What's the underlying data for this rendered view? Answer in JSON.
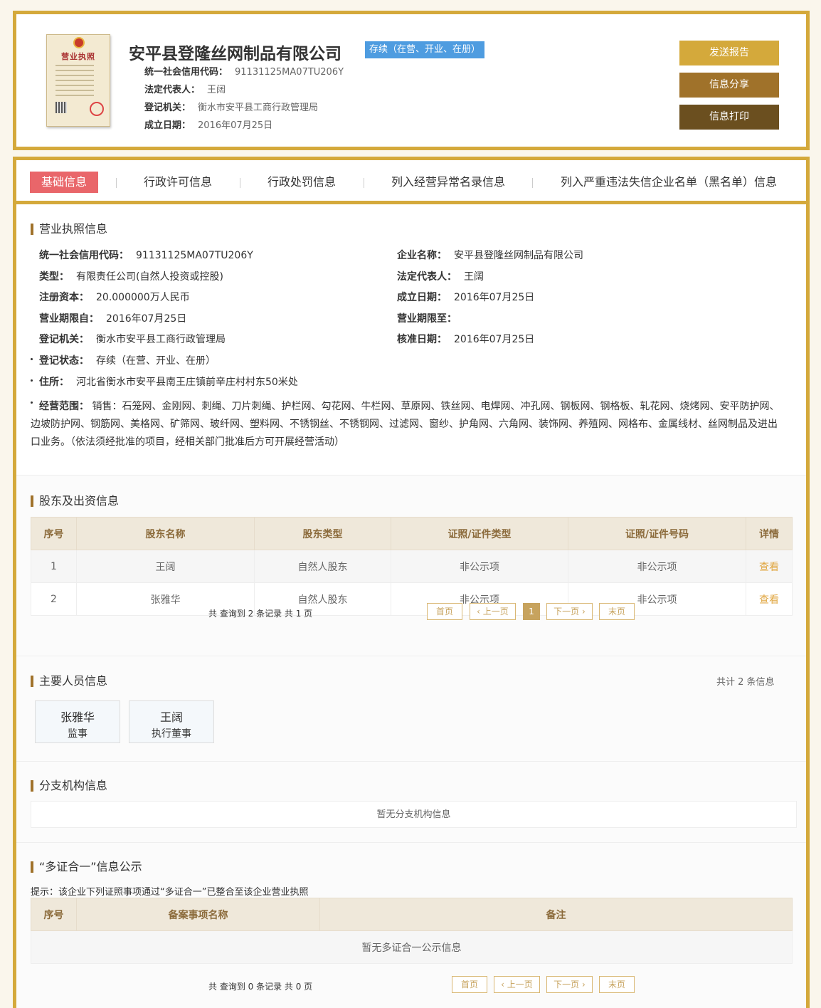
{
  "header": {
    "company_name": "安平县登隆丝网制品有限公司",
    "status_tag": "存续（在营、开业、在册）",
    "license_label": "营业执照",
    "credit_code_label": "统一社会信用代码：",
    "credit_code": "91131125MA07TU206Y",
    "legal_rep_label": "法定代表人：",
    "legal_rep": "王阔",
    "reg_authority_label": "登记机关：",
    "reg_authority": "衡水市安平县工商行政管理局",
    "est_date_label": "成立日期：",
    "est_date": "2016年07月25日",
    "buttons": {
      "send_report": "发送报告",
      "share": "信息分享",
      "print": "信息打印"
    },
    "colors": {
      "accent": "#d4a93b",
      "status": "#4e9ce0"
    }
  },
  "tabs": [
    "基础信息",
    "行政许可信息",
    "行政处罚信息",
    "列入经营异常名录信息",
    "列入严重违法失信企业名单（黑名单）信息"
  ],
  "license_info": {
    "title": "营业执照信息",
    "credit_code_label": "统一社会信用代码：",
    "credit_code": "91131125MA07TU206Y",
    "company_name_label": "企业名称：",
    "company_name": "安平县登隆丝网制品有限公司",
    "type_label": "类型：",
    "type": "有限责任公司(自然人投资或控股)",
    "legal_rep_label": "法定代表人：",
    "legal_rep": "王阔",
    "capital_label": "注册资本：",
    "capital": "20.000000万人民币",
    "est_date_label": "成立日期：",
    "est_date": "2016年07月25日",
    "term_from_label": "营业期限自：",
    "term_from": "2016年07月25日",
    "term_to_label": "营业期限至：",
    "term_to": "",
    "reg_authority_label": "登记机关：",
    "reg_authority": "衡水市安平县工商行政管理局",
    "approval_date_label": "核准日期：",
    "approval_date": "2016年07月25日",
    "reg_status_label": "登记状态：",
    "reg_status": "存续（在营、开业、在册）",
    "address_label": "住所：",
    "address": "河北省衡水市安平县南王庄镇前辛庄村村东50米处",
    "scope_label": "经营范围：",
    "scope": "销售：石笼网、金刚网、刺绳、刀片刺绳、护栏网、勾花网、牛栏网、草原网、铁丝网、电焊网、冲孔网、钢板网、钢格板、轧花网、烧烤网、安平防护网、边坡防护网、钢筋网、美格网、矿筛网、玻纤网、塑料网、不锈钢丝、不锈钢网、过滤网、窗纱、护角网、六角网、装饰网、养殖网、网格布、金属线材、丝网制品及进出口业务。（依法须经批准的项目，经相关部门批准后方可开展经营活动）"
  },
  "shareholders": {
    "title": "股东及出资信息",
    "headers": [
      "序号",
      "股东名称",
      "股东类型",
      "证照/证件类型",
      "证照/证件号码",
      "详情"
    ],
    "rows": [
      [
        "1",
        "王阔",
        "自然人股东",
        "非公示项",
        "非公示项",
        "查看"
      ],
      [
        "2",
        "张雅华",
        "自然人股东",
        "非公示项",
        "非公示项",
        "查看"
      ]
    ],
    "pager_info": "共 查询到 2 条记录 共 1 页",
    "pager": {
      "first": "首页",
      "prev": "上一页",
      "current": "1",
      "next": "下一页",
      "last": "末页"
    }
  },
  "personnel": {
    "title": "主要人员信息",
    "total": "共计 2 条信息",
    "people": [
      {
        "name": "张雅华",
        "role": "监事"
      },
      {
        "name": "王阔",
        "role": "执行董事"
      }
    ]
  },
  "branches": {
    "title": "分支机构信息",
    "empty": "暂无分支机构信息"
  },
  "multi_cert": {
    "title": "“多证合一”信息公示",
    "hint": "提示：该企业下列证照事项通过“多证合一”已整合至该企业营业执照",
    "headers": [
      "序号",
      "备案事项名称",
      "备注"
    ],
    "empty": "暂无多证合一公示信息",
    "pager_info": "共 查询到 0 条记录 共 0 页",
    "pager": {
      "first": "首页",
      "prev": "上一页",
      "next": "下一页",
      "last": "末页"
    }
  }
}
